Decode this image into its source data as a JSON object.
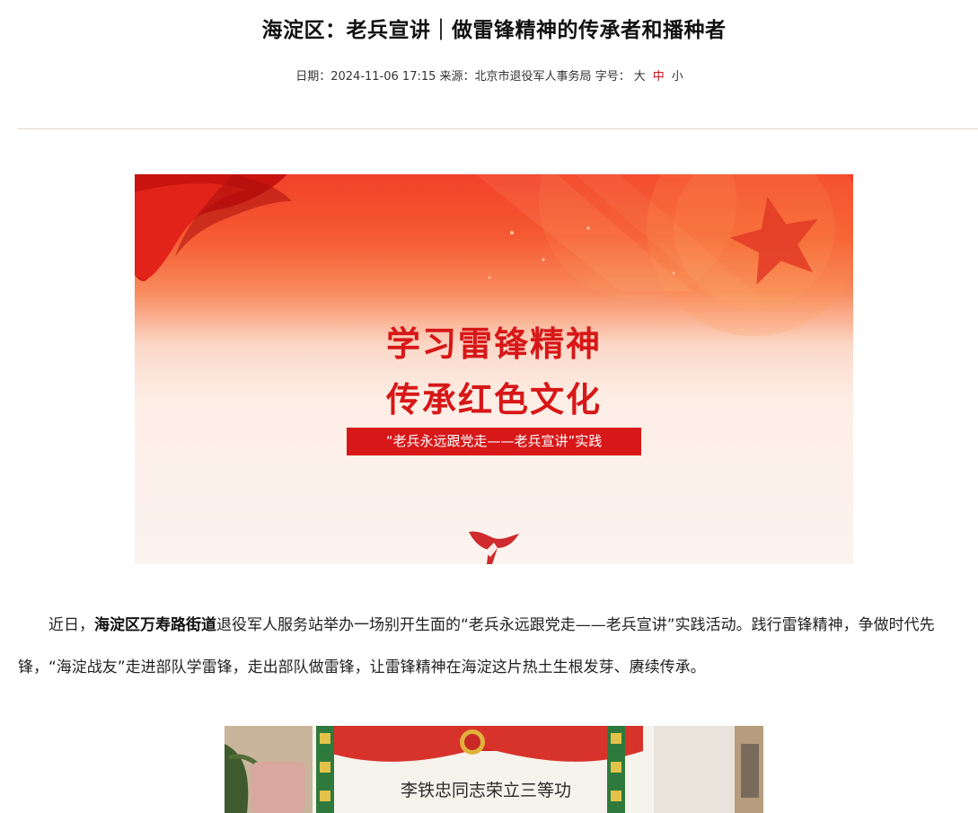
{
  "article": {
    "title": "海淀区：老兵宣讲｜做雷锋精神的传承者和播种者",
    "meta": {
      "date_label": "日期：",
      "date": "2024-11-06 17:15",
      "source_label": "来源：",
      "source": "北京市退役军人事务局",
      "fontsize_label": "字号：",
      "size_large": "大",
      "size_medium": "中",
      "size_small": "小"
    },
    "banner": {
      "line1": "学习雷锋精神",
      "line2": "传承红色文化",
      "tag": "“老兵永远跟党走——老兵宣讲”实践"
    },
    "paragraph": {
      "lead": "近日，",
      "bold": "海淀区万寿路街道",
      "text": "退役军人服务站举办一场别开生面的“老兵永远跟党走——老兵宣讲”实践活动。践行雷锋精神，争做时代先锋，“海淀战友”走进部队学雷锋，走出部队做雷锋，让雷锋精神在海淀这片热土生根发芽、赓续传承。"
    },
    "photo": {
      "certificate_text": "李铁忠同志荣立三等功"
    }
  },
  "colors": {
    "accent_red": "#d71718",
    "active_size": "#c4161c",
    "divider": "#e5d3c6"
  }
}
